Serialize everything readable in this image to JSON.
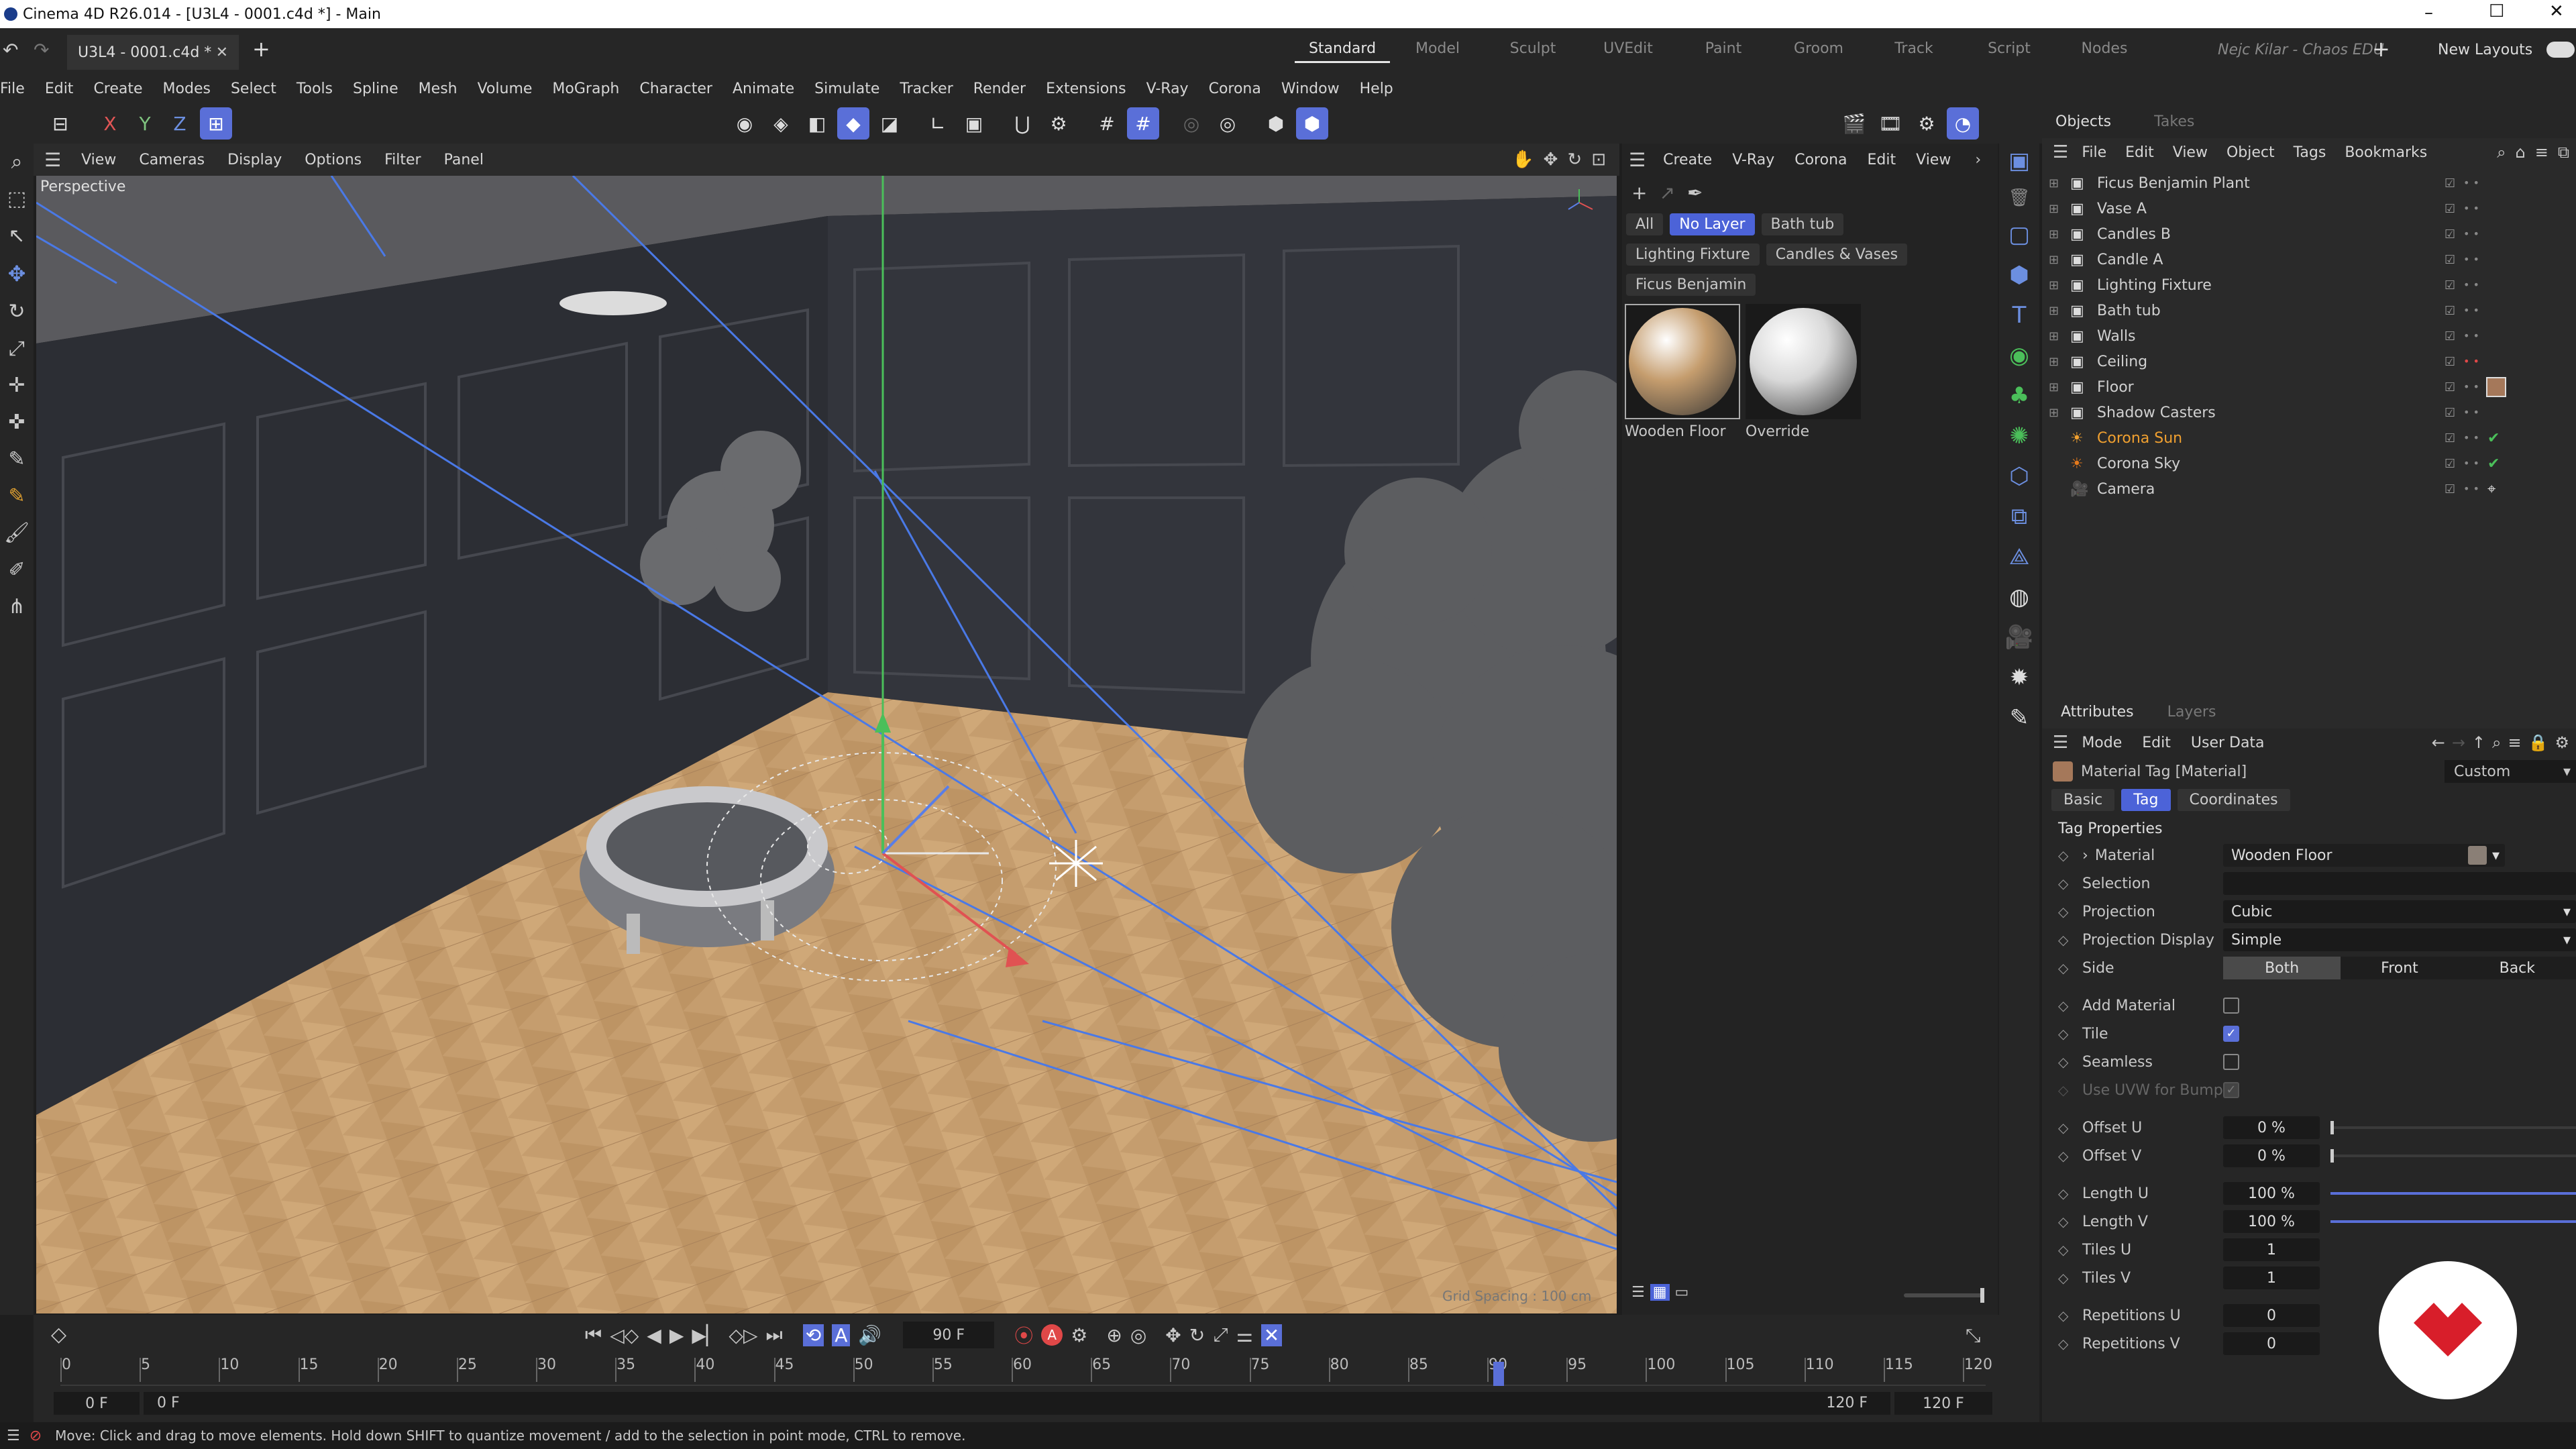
{
  "titlebar": {
    "title": "Cinema 4D R26.014 - [U3L4 - 0001.c4d *] - Main"
  },
  "tabs": {
    "doc_tab": "U3L4 - 0001.c4d *",
    "layouts": [
      "Standard",
      "Model",
      "Sculpt",
      "UVEdit",
      "Paint",
      "Groom",
      "Track",
      "Script",
      "Nodes"
    ],
    "active_layout": "Standard",
    "user": "Nejc Kilar - Chaos EDU",
    "new_layouts": "New Layouts"
  },
  "menu": [
    "File",
    "Edit",
    "Create",
    "Modes",
    "Select",
    "Tools",
    "Spline",
    "Mesh",
    "Volume",
    "MoGraph",
    "Character",
    "Animate",
    "Simulate",
    "Tracker",
    "Render",
    "Extensions",
    "V-Ray",
    "Corona",
    "Window",
    "Help"
  ],
  "axis_toggles": [
    "X",
    "Y",
    "Z"
  ],
  "viewport": {
    "menu": [
      "View",
      "Cameras",
      "Display",
      "Options",
      "Filter",
      "Panel"
    ],
    "label": "Perspective",
    "grid": "Grid Spacing : 100 cm"
  },
  "materials": {
    "menu": [
      "Create",
      "V-Ray",
      "Corona",
      "Edit",
      "View"
    ],
    "filters_row1": [
      "All",
      "No Layer",
      "Bath tub"
    ],
    "filters_row2": [
      "Lighting Fixture",
      "Candles & Vases"
    ],
    "filters_row3": [
      "Ficus Benjamin"
    ],
    "active_filter": "No Layer",
    "swatches": [
      {
        "name": "Wooden Floor",
        "color": "#c59d6e"
      },
      {
        "name": "Override",
        "color": "#d9d9d9"
      }
    ]
  },
  "objects": {
    "tabs": [
      "Objects",
      "Takes"
    ],
    "menu": [
      "File",
      "Edit",
      "View",
      "Object",
      "Tags",
      "Bookmarks"
    ],
    "items": [
      {
        "name": "Ficus Benjamin Plant",
        "color": "#d0d0d0"
      },
      {
        "name": "Vase A",
        "color": "#d0d0d0"
      },
      {
        "name": "Candles B",
        "color": "#d0d0d0"
      },
      {
        "name": "Candle A",
        "color": "#d0d0d0"
      },
      {
        "name": "Lighting Fixture",
        "color": "#d0d0d0"
      },
      {
        "name": "Bath tub",
        "color": "#d0d0d0"
      },
      {
        "name": "Walls",
        "color": "#d0d0d0"
      },
      {
        "name": "Ceiling",
        "color": "#d0d0d0"
      },
      {
        "name": "Floor",
        "color": "#d0d0d0"
      },
      {
        "name": "Shadow Casters",
        "color": "#d0d0d0"
      },
      {
        "name": "Corona Sun",
        "color": "#f0a030"
      },
      {
        "name": "Corona Sky",
        "color": "#d0d0d0"
      },
      {
        "name": "Camera",
        "color": "#d0d0d0"
      }
    ]
  },
  "attributes": {
    "tabs": [
      "Attributes",
      "Layers"
    ],
    "menu": [
      "Mode",
      "Edit",
      "User Data"
    ],
    "object_title": "Material Tag [Material]",
    "preset": "Custom",
    "subtabs": [
      "Basic",
      "Tag",
      "Coordinates"
    ],
    "active_subtab": "Tag",
    "section": "Tag Properties",
    "material_label": "Material",
    "material_value": "Wooden Floor",
    "selection_label": "Selection",
    "projection_label": "Projection",
    "projection_value": "Cubic",
    "projection_display_label": "Projection Display",
    "projection_display_value": "Simple",
    "side_label": "Side",
    "side_options": [
      "Both",
      "Front",
      "Back"
    ],
    "side_selected": "Both",
    "add_material_label": "Add Material",
    "tile_label": "Tile",
    "seamless_label": "Seamless",
    "use_uvw_label": "Use UVW for Bump",
    "offset_u_label": "Offset U",
    "offset_u": "0 %",
    "offset_v_label": "Offset V",
    "offset_v": "0 %",
    "length_u_label": "Length U",
    "length_u": "100 %",
    "length_v_label": "Length V",
    "length_v": "100 %",
    "tiles_u_label": "Tiles U",
    "tiles_u": "1",
    "tiles_v_label": "Tiles V",
    "tiles_v": "1",
    "rep_u_label": "Repetitions U",
    "rep_u": "0",
    "rep_v_label": "Repetitions V",
    "rep_v": "0"
  },
  "timeline": {
    "current_frame": "90 F",
    "ticks": [
      "0",
      "5",
      "10",
      "15",
      "20",
      "25",
      "30",
      "35",
      "40",
      "45",
      "50",
      "55",
      "60",
      "65",
      "70",
      "75",
      "80",
      "85",
      "90",
      "95",
      "100",
      "105",
      "110",
      "115",
      "120"
    ],
    "start": "0 F",
    "start2": "0 F",
    "end": "120 F",
    "end2": "120 F"
  },
  "status": {
    "text": "Move: Click and drag to move elements. Hold down SHIFT to quantize movement / add to the selection in point mode, CTRL to remove."
  }
}
